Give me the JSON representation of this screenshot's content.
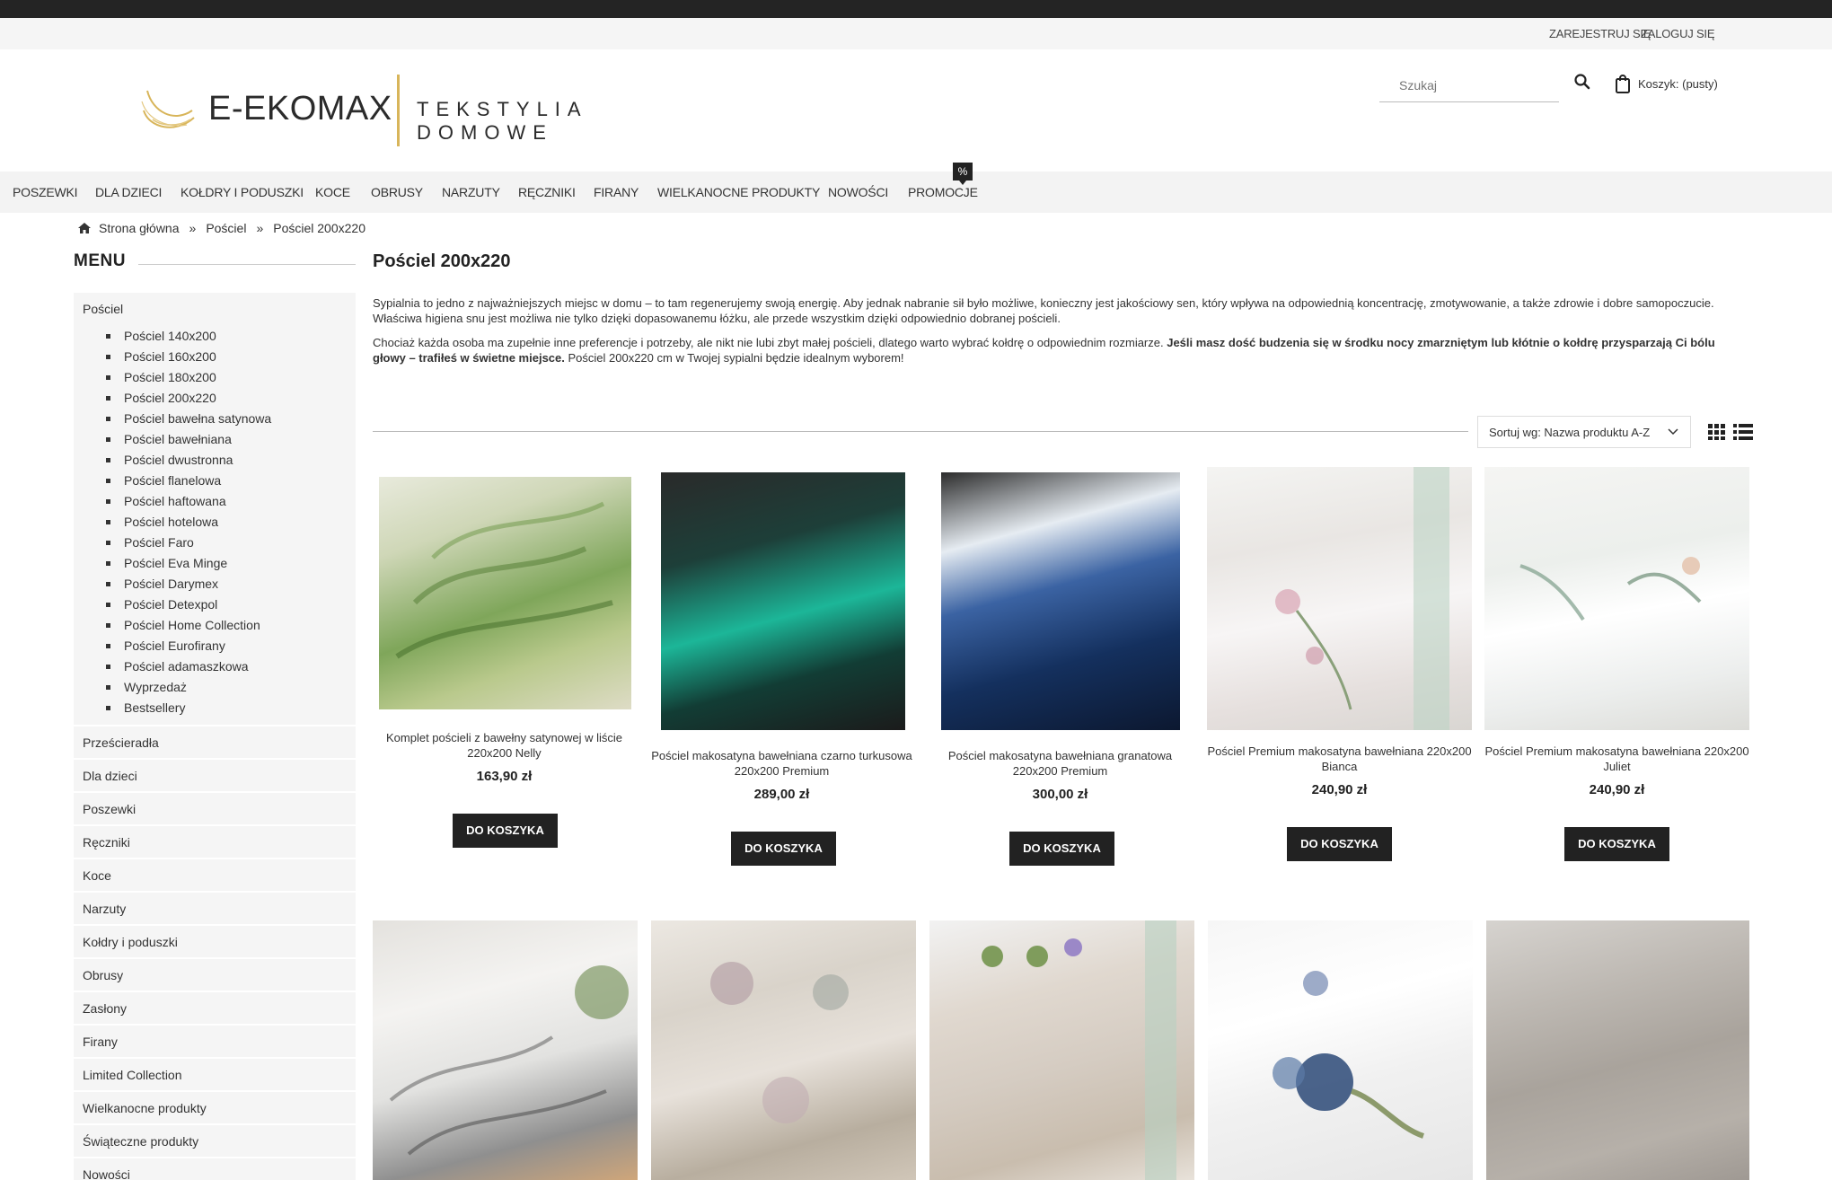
{
  "userbar": {
    "register": "ZAREJESTRUJ SIĘ",
    "login": "ZALOGUJ SIĘ"
  },
  "logo": {
    "brand": "E-EKOMAX",
    "tagline": "TEKSTYLIA DOMOWE"
  },
  "search": {
    "placeholder": "Szukaj"
  },
  "cart": {
    "label": "Koszyk: (pusty)"
  },
  "nav": {
    "items": [
      "POSZEWKI",
      "DLA DZIECI",
      "KOŁDRY I PODUSZKI",
      "KOCE",
      "OBRUSY",
      "NARZUTY",
      "RĘCZNIKI",
      "FIRANY",
      "WIELKANOCNE PRODUKTY",
      "NOWOŚCI",
      "PROMOCJE"
    ],
    "promo_badge": "%"
  },
  "breadcrumb": {
    "home": "Strona główna",
    "sep": "»",
    "level1": "Pościel",
    "current": "Pościel 200x220"
  },
  "sidebar": {
    "title": "MENU",
    "open_category": "Pościel",
    "subcategories": [
      "Pościel 140x200",
      "Pościel 160x200",
      "Pościel 180x200",
      "Pościel 200x220",
      "Pościel bawełna satynowa",
      "Pościel bawełniana",
      "Pościel dwustronna",
      "Pościel flanelowa",
      "Pościel haftowana",
      "Pościel hotelowa",
      "Pościel Faro",
      "Pościel Eva Minge",
      "Pościel Darymex",
      "Pościel Detexpol",
      "Pościel Home Collection",
      "Pościel Eurofirany",
      "Pościel adamaszkowa",
      "Wyprzedaż",
      "Bestsellery"
    ],
    "categories": [
      "Prześcieradła",
      "Dla dzieci",
      "Poszewki",
      "Ręczniki",
      "Koce",
      "Narzuty",
      "Kołdry i poduszki",
      "Obrusy",
      "Zasłony",
      "Firany",
      "Limited Collection",
      "Wielkanocne produkty",
      "Świąteczne produkty",
      "Nowości"
    ]
  },
  "content": {
    "title": "Pościel 200x220",
    "p1": "Sypialnia to jedno z najważniejszych miejsc w domu – to tam regenerujemy swoją energię. Aby jednak nabranie sił było możliwe, konieczny jest jakościowy sen, który wpływa na odpowiednią koncentrację, zmotywowanie, a także zdrowie i dobre samopoczucie. Właściwa higiena snu jest możliwa nie tylko dzięki dopasowanemu łóżku, ale przede wszystkim dzięki odpowiednio dobranej pościeli.",
    "p2_start": "Chociaż każda osoba ma zupełnie inne preferencje i potrzeby, ale nikt nie lubi zbyt małej pościeli, dlatego warto wybrać kołdrę o odpowiednim rozmiarze. ",
    "p2_bold": "Jeśli masz dość budzenia się w środku nocy zmarzniętym lub kłótnie o kołdrę przysparzają Ci bólu głowy – trafiłeś w świetne miejsce.",
    "p2_end": " Pościel 200x220 cm w Twojej sypialni będzie idealnym wyborem!"
  },
  "sort": {
    "label": "Sortuj wg: Nazwa produktu A-Z"
  },
  "button_label": "DO KOSZYKA",
  "products": [
    {
      "name": "Komplet pościeli z bawełny satynowej w liście 220x200 Nelly",
      "price": "163,90 zł"
    },
    {
      "name": "Pościel makosatyna bawełniana czarno turkusowa 220x200 Premium",
      "price": "289,00 zł"
    },
    {
      "name": "Pościel makosatyna bawełniana granatowa 220x200 Premium",
      "price": "300,00 zł"
    },
    {
      "name": "Pościel Premium makosatyna bawełniana 220x200 Bianca",
      "price": "240,90 zł"
    },
    {
      "name": "Pościel Premium makosatyna bawełniana 220x200 Juliet",
      "price": "240,90 zł"
    }
  ],
  "colors": {
    "accent_gold": "#d8b55a",
    "dark": "#222222",
    "nav_bg": "#f3f3f3"
  }
}
